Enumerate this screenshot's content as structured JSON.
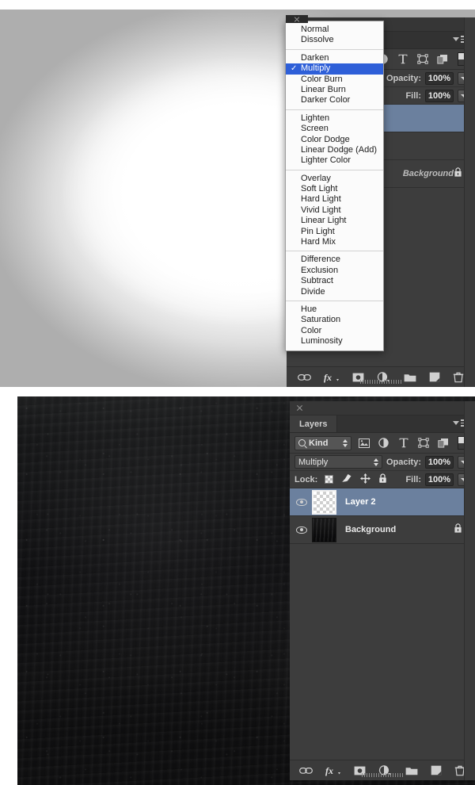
{
  "app": "Adobe Photoshop",
  "canvas_top": {
    "name": "white-vignette-canvas"
  },
  "canvas_bottom": {
    "name": "dark-chalkboard-canvas"
  },
  "blend_menu": {
    "title": "Blend Mode Menu",
    "selected": "Multiply",
    "groups": [
      [
        "Normal",
        "Dissolve"
      ],
      [
        "Darken",
        "Multiply",
        "Color Burn",
        "Linear Burn",
        "Darker Color"
      ],
      [
        "Lighten",
        "Screen",
        "Color Dodge",
        "Linear Dodge (Add)",
        "Lighter Color"
      ],
      [
        "Overlay",
        "Soft Light",
        "Hard Light",
        "Vivid Light",
        "Linear Light",
        "Pin Light",
        "Hard Mix"
      ],
      [
        "Difference",
        "Exclusion",
        "Subtract",
        "Divide"
      ],
      [
        "Hue",
        "Saturation",
        "Color",
        "Luminosity"
      ]
    ]
  },
  "panel_top": {
    "opacity_label": "Opacity:",
    "opacity_value": "100%",
    "fill_label": "Fill:",
    "fill_value": "100%",
    "background_layer_name": "Background"
  },
  "panel_bottom": {
    "tab_label": "Layers",
    "filter_kind_label": "Kind",
    "blend_mode": "Multiply",
    "opacity_label": "Opacity:",
    "opacity_value": "100%",
    "lock_label": "Lock:",
    "fill_label": "Fill:",
    "fill_value": "100%",
    "layers": [
      {
        "name": "Layer 2",
        "selected": true,
        "locked": false,
        "visible": true,
        "thumb": "transparent-checker"
      },
      {
        "name": "Background",
        "selected": false,
        "locked": true,
        "visible": true,
        "thumb": "dark-texture"
      }
    ],
    "bottom_icons": [
      "link-icon",
      "fx-icon",
      "layer-mask-icon",
      "adjustment-layer-icon",
      "new-group-icon",
      "new-layer-icon",
      "delete-layer-icon"
    ]
  },
  "colors": {
    "panel_bg": "#3d3d3d",
    "selected_layer": "#6b809e",
    "menu_highlight": "#2e5fd8",
    "text": "#d0d0d0"
  }
}
